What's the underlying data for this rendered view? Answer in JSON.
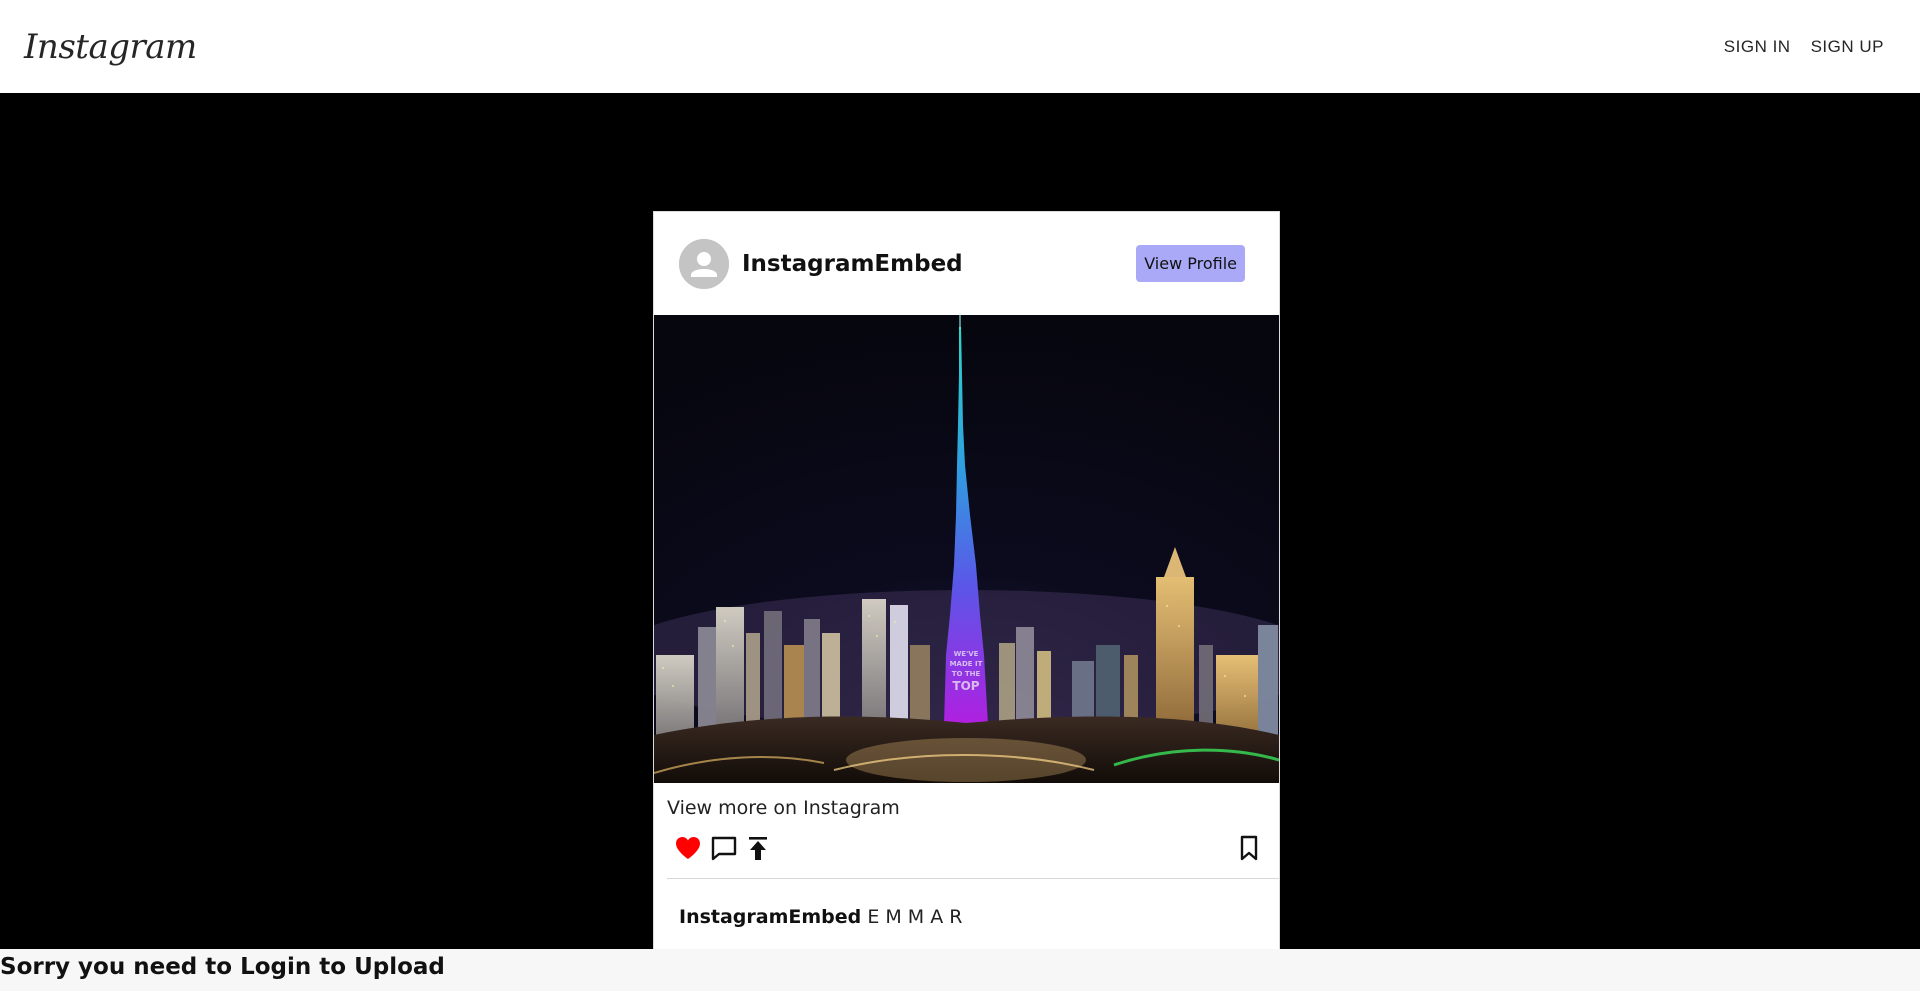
{
  "header": {
    "logo_text": "Instagram",
    "nav": [
      {
        "label": "SIGN IN"
      },
      {
        "label": "SIGN UP"
      }
    ]
  },
  "post": {
    "username": "InstagramEmbed",
    "view_profile_label": "View Profile",
    "image_alt": "Burj Khalifa lit in blue and purple at night over the Dubai skyline",
    "tower_text": [
      "WE'VE",
      "MADE IT",
      "TO THE",
      "TOP"
    ],
    "view_more_label": "View more on Instagram",
    "actions": {
      "like_icon": "heart-icon",
      "comment_icon": "comment-icon",
      "share_icon": "share-icon",
      "save_icon": "bookmark-icon",
      "like_color": "#ff0000"
    },
    "caption": {
      "username": "InstagramEmbed",
      "text": "E M M A R"
    }
  },
  "footer": {
    "message": "Sorry you need to Login to Upload"
  },
  "colors": {
    "stage_bg": "#000000",
    "view_profile_bg": "#a9a9f7",
    "footer_bg": "#f7f7f7"
  }
}
